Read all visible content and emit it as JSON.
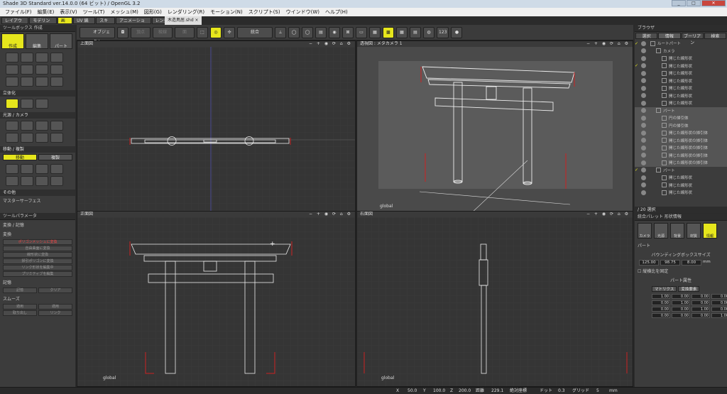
{
  "window": {
    "title": "Shade 3D Standard ver.14.0.0 (64 ビット) / OpenGL 3.2"
  },
  "menu": [
    "ファイル(F)",
    "編集(E)",
    "表示(V)",
    "ツール(T)",
    "メッシュ(M)",
    "図形(G)",
    "レンダリング(R)",
    "モーション(N)",
    "スクリプト(S)",
    "ウインドウ(W)",
    "ヘルプ(H)"
  ],
  "workspace_tabs": [
    "レイアウト",
    "モデリング",
    "画像",
    "UV 編集",
    "スキン",
    "アニメーション",
    "レンダリング",
    "+ −"
  ],
  "document_tab": "木造鳥居.shd ×",
  "toolbar": {
    "object_label": "オブジェクト",
    "b1": "頂点",
    "b2": "稜線",
    "b3": "面",
    "merge_label": "統合"
  },
  "toolbox": {
    "title": "ツールボックス  作成",
    "modes": [
      "作成",
      "編集",
      "パート"
    ],
    "sec_solid": "立体化",
    "sec_light": "光源 / カメラ",
    "sec_move": "移動 / 複製",
    "move_btn": "移動",
    "copy_btn": "複製",
    "sec_other": "その他",
    "master": "マスターサーフェス"
  },
  "toolparam": {
    "title": "ツールパラメータ",
    "section": "変換 / 記憶",
    "sub": "変換",
    "buttons": [
      "ポリゴンメッシュに変換",
      "自由曲面に変換",
      "線形状に変換",
      "掃引ポリゴンに変換",
      "リンク形状を編集中",
      "プリミティブを編集"
    ],
    "memory": "記憶",
    "mem_btns": [
      "記憶",
      "クリア"
    ],
    "smooth": "スムーズ",
    "smooth_btns": [
      "適用",
      "適用",
      "取り出し",
      "リンク"
    ]
  },
  "viewports": {
    "top": {
      "label": "上面図",
      "controls": "− + ◉ ⟳ ⌂ ⚙"
    },
    "persp": {
      "label": "透視図 : メタカメラ 1",
      "controls": "− + ◉ ⟳ ⌂ ⚙"
    },
    "front": {
      "label": "正面図",
      "controls": "− + ◉ ⟳ ⌂ ⚙"
    },
    "right": {
      "label": "右面図",
      "controls": "− + ◉ ⟳ ⌂ ⚙"
    },
    "global": "global"
  },
  "browser": {
    "title": "ブラウザ",
    "tabs": [
      "選択",
      "情報",
      "ブーリアン",
      "検索"
    ],
    "items": [
      {
        "label": "ルートパート",
        "check": true,
        "hl": false,
        "indent": 0
      },
      {
        "label": "カメラ",
        "check": false,
        "hl": false,
        "indent": 1
      },
      {
        "label": "開じた線形状",
        "check": false,
        "hl": false,
        "indent": 2
      },
      {
        "label": "開じた線形状",
        "check": true,
        "hl": false,
        "indent": 2
      },
      {
        "label": "開じた線形状",
        "check": false,
        "hl": false,
        "indent": 2
      },
      {
        "label": "開じた線形状",
        "check": false,
        "hl": false,
        "indent": 2
      },
      {
        "label": "開じた線形状",
        "check": false,
        "hl": false,
        "indent": 2
      },
      {
        "label": "開じた線形状",
        "check": false,
        "hl": false,
        "indent": 2
      },
      {
        "label": "開じた線形状",
        "check": false,
        "hl": false,
        "indent": 2
      },
      {
        "label": "パート",
        "check": false,
        "hl": true,
        "indent": 1
      },
      {
        "label": "円の掃引体",
        "check": false,
        "hl": true,
        "indent": 2
      },
      {
        "label": "円の掃引体",
        "check": false,
        "hl": true,
        "indent": 2
      },
      {
        "label": "開じた線形状の掃引体",
        "check": false,
        "hl": true,
        "indent": 2
      },
      {
        "label": "開じた線形状の掃引体",
        "check": false,
        "hl": true,
        "indent": 2
      },
      {
        "label": "開じた線形状の掃引体",
        "check": false,
        "hl": true,
        "indent": 2
      },
      {
        "label": "開じた線形状の掃引体",
        "check": false,
        "hl": true,
        "indent": 2
      },
      {
        "label": "開じた線形状の掃引体",
        "check": false,
        "hl": true,
        "indent": 2
      },
      {
        "label": "パート",
        "check": true,
        "hl": false,
        "indent": 1
      },
      {
        "label": "開じた線形状",
        "check": false,
        "hl": false,
        "indent": 2
      },
      {
        "label": "開じた線形状",
        "check": false,
        "hl": false,
        "indent": 2
      },
      {
        "label": "開じた線形状",
        "check": false,
        "hl": false,
        "indent": 2
      }
    ],
    "footer": "/ 20 選択"
  },
  "shapeinfo": {
    "title": "統合パレット  形状情報",
    "icons": [
      "カメラ",
      "光源",
      "背景",
      "材質",
      "情報"
    ],
    "part": "パート",
    "bbox_title": "バウンディングボックスサイズ",
    "bbox": [
      "125.00",
      "98.75",
      "8.00"
    ],
    "unit": "mm",
    "fix": "縦横比を固定",
    "attr": "パート属性",
    "matrix_tabs": [
      "マトリクス",
      "変換要素"
    ],
    "matrix": [
      "1.00",
      "0.00",
      "0.00",
      "0.00",
      "0.00",
      "1.00",
      "0.00",
      "0.00",
      "0.00",
      "0.00",
      "1.00",
      "0.00",
      "0.00",
      "0.00",
      "0.00",
      "1.00"
    ]
  },
  "status": {
    "x": "X",
    "xv": "50.0",
    "y": "Y",
    "yv": "100.0",
    "z": "Z",
    "zv": "200.0",
    "dist": "距離",
    "distv": "229.1",
    "coord": "絶対座標",
    "dot": "ドット",
    "dotv": "0.3",
    "grid": "グリッド",
    "gridv": "5",
    "unit": "mm"
  }
}
